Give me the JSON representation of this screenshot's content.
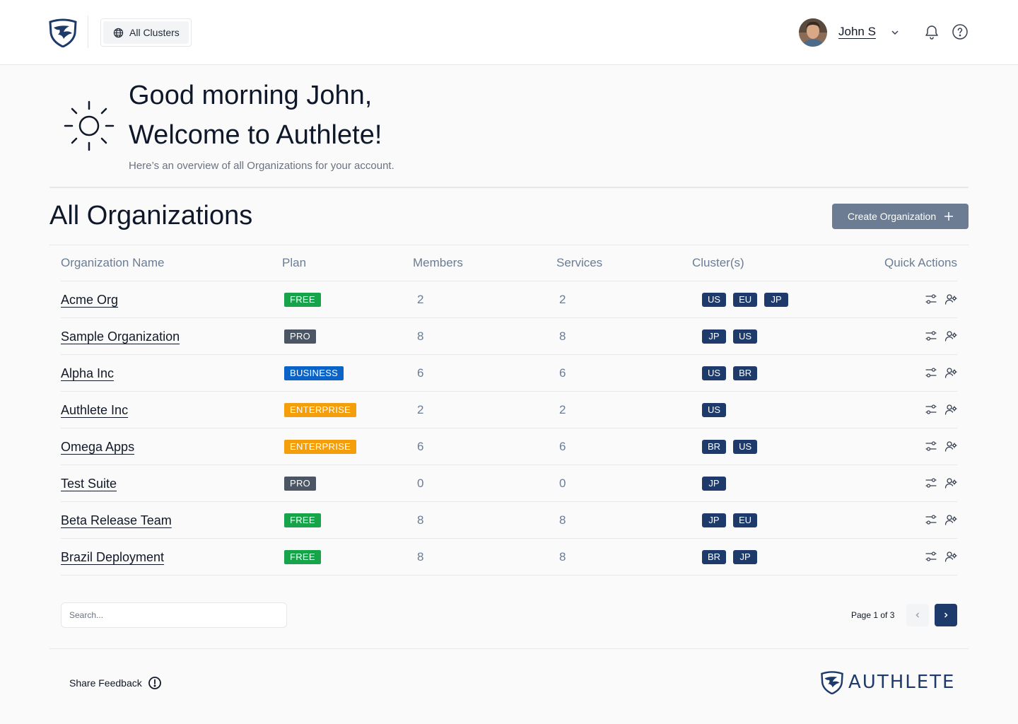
{
  "header": {
    "cluster_selector_label": "All Clusters",
    "user_name": "John S"
  },
  "greeting": {
    "line1": "Good morning John,",
    "line2": "Welcome to Authlete!",
    "subtitle": "Here’s an overview of all Organizations for your account."
  },
  "section": {
    "title": "All Organizations",
    "create_button_label": "Create Organization"
  },
  "table": {
    "columns": {
      "name": "Organization Name",
      "plan": "Plan",
      "members": "Members",
      "services": "Services",
      "clusters": "Cluster(s)",
      "actions": "Quick Actions"
    },
    "rows": [
      {
        "name": "Acme Org",
        "plan": "FREE",
        "members": "2",
        "services": "2",
        "clusters": [
          "US",
          "EU",
          "JP"
        ]
      },
      {
        "name": "Sample Organization",
        "plan": "PRO",
        "members": "8",
        "services": "8",
        "clusters": [
          "JP",
          "US"
        ]
      },
      {
        "name": "Alpha Inc",
        "plan": "BUSINESS",
        "members": "6",
        "services": "6",
        "clusters": [
          "US",
          "BR"
        ]
      },
      {
        "name": "Authlete Inc",
        "plan": "ENTERPRISE",
        "members": "2",
        "services": "2",
        "clusters": [
          "US"
        ]
      },
      {
        "name": "Omega Apps",
        "plan": "ENTERPRISE",
        "members": "6",
        "services": "6",
        "clusters": [
          "BR",
          "US"
        ]
      },
      {
        "name": "Test Suite",
        "plan": "PRO",
        "members": "0",
        "services": "0",
        "clusters": [
          "JP"
        ]
      },
      {
        "name": "Beta Release Team",
        "plan": "FREE",
        "members": "8",
        "services": "8",
        "clusters": [
          "JP",
          "EU"
        ]
      },
      {
        "name": "Brazil Deployment",
        "plan": "FREE",
        "members": "8",
        "services": "8",
        "clusters": [
          "BR",
          "JP"
        ]
      }
    ]
  },
  "plan_colors": {
    "FREE": "#16a34a",
    "PRO": "#4b5563",
    "BUSINESS": "#0b63c7",
    "ENTERPRISE": "#f59e0b"
  },
  "cluster_badge_color": "#1e3a6b",
  "search": {
    "placeholder": "Search..."
  },
  "pagination": {
    "label": "Page 1 of 3"
  },
  "footer": {
    "feedback_label": "Share Feedback",
    "logo_text": "AUTHLETE"
  },
  "icons": {
    "cluster_selector": "globe-icon",
    "user_menu": "chevron-down-icon",
    "notifications": "bell-icon",
    "help": "help-circle-icon",
    "greeting": "sun-icon",
    "create": "plus-icon",
    "row_action_1": "sliders-icon",
    "row_action_2": "user-settings-icon",
    "prev": "chevron-left-icon",
    "next": "chevron-right-icon",
    "feedback": "alert-circle-icon"
  }
}
